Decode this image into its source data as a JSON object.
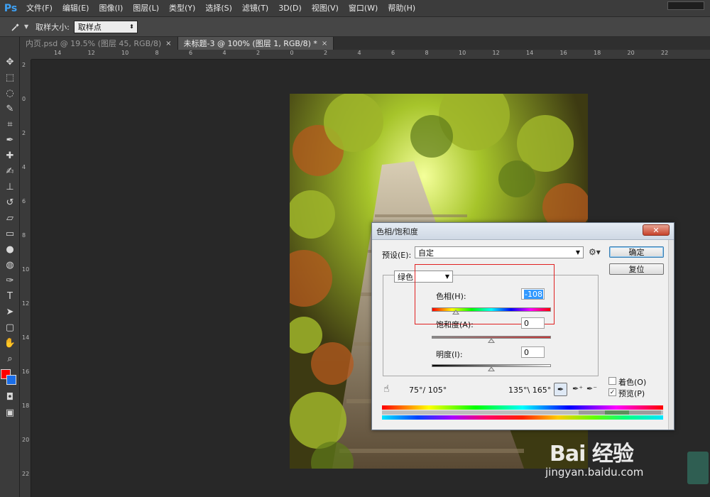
{
  "app": {
    "logo": "Ps"
  },
  "menu": {
    "items": [
      "文件(F)",
      "编辑(E)",
      "图像(I)",
      "图层(L)",
      "类型(Y)",
      "选择(S)",
      "滤镜(T)",
      "3D(D)",
      "视图(V)",
      "窗口(W)",
      "帮助(H)"
    ]
  },
  "options": {
    "sample_label": "取样大小:",
    "sample_value": "取样点",
    "tool_icon": "eyedropper-icon"
  },
  "tabs": [
    {
      "label": "内页.psd @ 19.5% (图层 45, RGB/8)",
      "close": "×"
    },
    {
      "label": "未标题-3 @ 100% (图层 1, RGB/8) *",
      "close": "×"
    }
  ],
  "ruler": {
    "top": [
      "14",
      "12",
      "10",
      "8",
      "6",
      "4",
      "2",
      "0",
      "2",
      "4",
      "6",
      "8",
      "10",
      "12",
      "14",
      "16",
      "18",
      "20",
      "22"
    ],
    "left": [
      "2",
      "0",
      "2",
      "4",
      "6",
      "8",
      "10",
      "12",
      "14",
      "16",
      "18",
      "20",
      "22"
    ]
  },
  "dialog": {
    "title": "色相/饱和度",
    "close": "✕",
    "preset_label": "预设(E):",
    "preset_value": "自定",
    "ok": "确定",
    "reset": "复位",
    "channel": "绿色",
    "hue_label": "色相(H):",
    "hue_value": "-108",
    "hue_level": 0.2,
    "sat_label": "饱和度(A):",
    "sat_value": "0",
    "sat_level": 0.5,
    "light_label": "明度(I):",
    "light_value": "0",
    "light_level": 0.5,
    "range_left": "75°/ 105°",
    "range_right": "135°\\ 165°",
    "colorize_label": "着色(O)",
    "colorize_checked": false,
    "preview_label": "预览(P)",
    "preview_checked": true,
    "preview_mark": "✓"
  },
  "watermark": {
    "brand": "Bai 经验",
    "url": "jingyan.baidu.com"
  }
}
